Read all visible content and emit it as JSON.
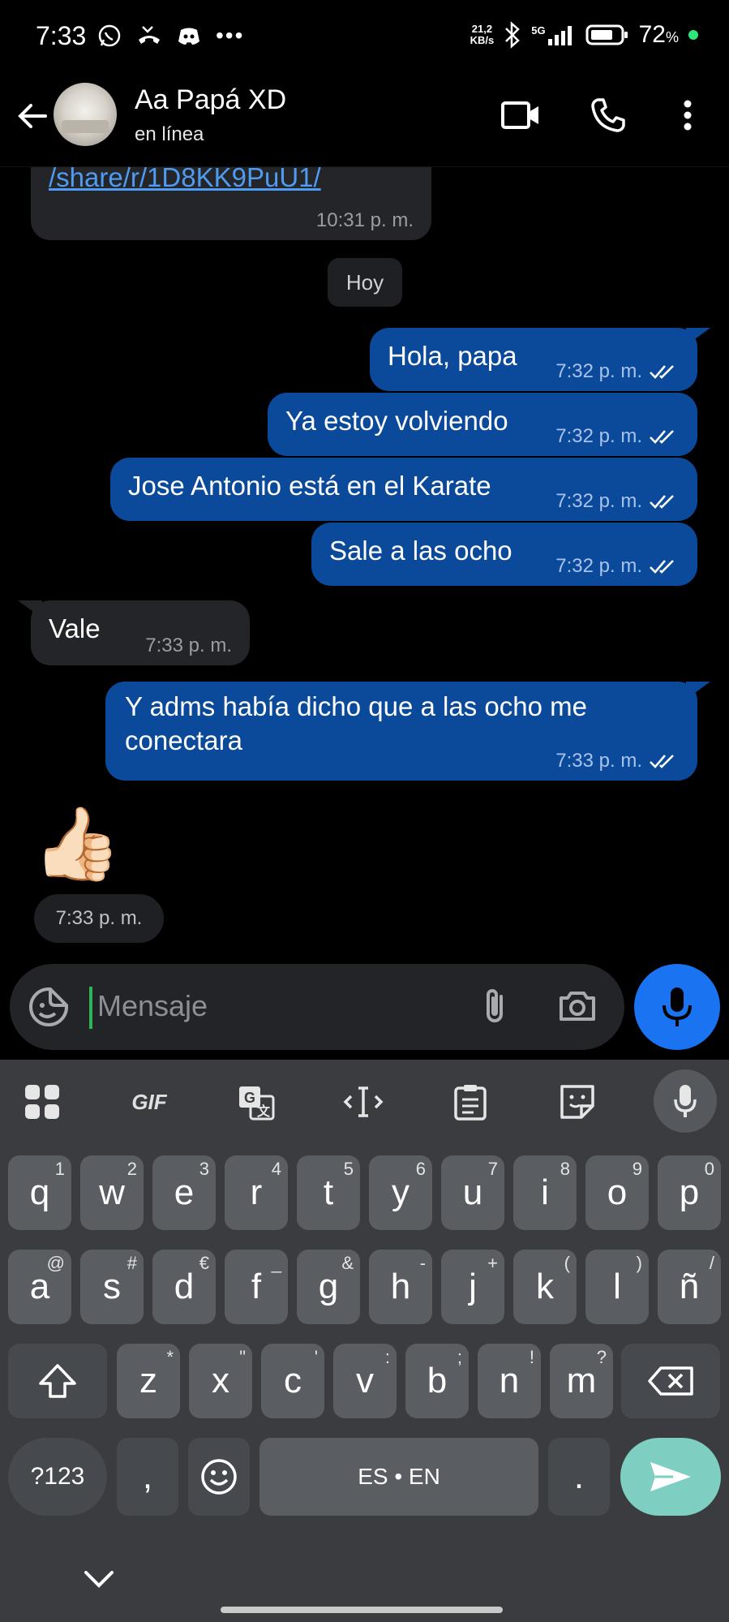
{
  "status_bar": {
    "time": "7:33",
    "net_speed_value": "21,2",
    "net_speed_unit": "KB/s",
    "network": "5G",
    "battery_percent": "72",
    "percent_sign": "%"
  },
  "header": {
    "contact_name": "Aa Papá XD",
    "contact_status": "en línea"
  },
  "chat": {
    "date_chip": "Hoy",
    "messages": [
      {
        "direction": "in",
        "text": "/share/r/1D8KK9PuU1/",
        "time": "10:31 p. m."
      },
      {
        "direction": "out",
        "text": "Hola, papa",
        "time": "7:32 p. m.",
        "status": "read"
      },
      {
        "direction": "out",
        "text": "Ya estoy volviendo",
        "time": "7:32 p. m.",
        "status": "read"
      },
      {
        "direction": "out",
        "text": "Jose Antonio está en el Karate",
        "time": "7:32 p. m.",
        "status": "read"
      },
      {
        "direction": "out",
        "text": "Sale a las ocho",
        "time": "7:32 p. m.",
        "status": "read"
      },
      {
        "direction": "in",
        "text": "Vale",
        "time": "7:33 p. m."
      },
      {
        "direction": "out",
        "text_line1": "Y adms había dicho que a las ocho me",
        "text_line2": "conectara",
        "time": "7:33 p. m.",
        "status": "read"
      },
      {
        "direction": "in",
        "text": "👍🏻",
        "time": "7:33 p. m."
      }
    ]
  },
  "composer": {
    "placeholder": "Mensaje"
  },
  "keyboard": {
    "toolbar": {
      "gif_label": "GIF"
    },
    "row1": [
      {
        "k": "q",
        "s": "1"
      },
      {
        "k": "w",
        "s": "2"
      },
      {
        "k": "e",
        "s": "3"
      },
      {
        "k": "r",
        "s": "4"
      },
      {
        "k": "t",
        "s": "5"
      },
      {
        "k": "y",
        "s": "6"
      },
      {
        "k": "u",
        "s": "7"
      },
      {
        "k": "i",
        "s": "8"
      },
      {
        "k": "o",
        "s": "9"
      },
      {
        "k": "p",
        "s": "0"
      }
    ],
    "row2": [
      {
        "k": "a",
        "s": "@"
      },
      {
        "k": "s",
        "s": "#"
      },
      {
        "k": "d",
        "s": "€"
      },
      {
        "k": "f",
        "s": "_"
      },
      {
        "k": "g",
        "s": "&"
      },
      {
        "k": "h",
        "s": "-"
      },
      {
        "k": "j",
        "s": "+"
      },
      {
        "k": "k",
        "s": "("
      },
      {
        "k": "l",
        "s": ")"
      },
      {
        "k": "ñ",
        "s": "/"
      }
    ],
    "row3": [
      {
        "k": "z",
        "s": "*"
      },
      {
        "k": "x",
        "s": "\""
      },
      {
        "k": "c",
        "s": "'"
      },
      {
        "k": "v",
        "s": ":"
      },
      {
        "k": "b",
        "s": ";"
      },
      {
        "k": "n",
        "s": "!"
      },
      {
        "k": "m",
        "s": "?"
      }
    ],
    "symbols_key": "?123",
    "comma_key": ",",
    "space_label": "ES • EN",
    "period_key": "."
  }
}
